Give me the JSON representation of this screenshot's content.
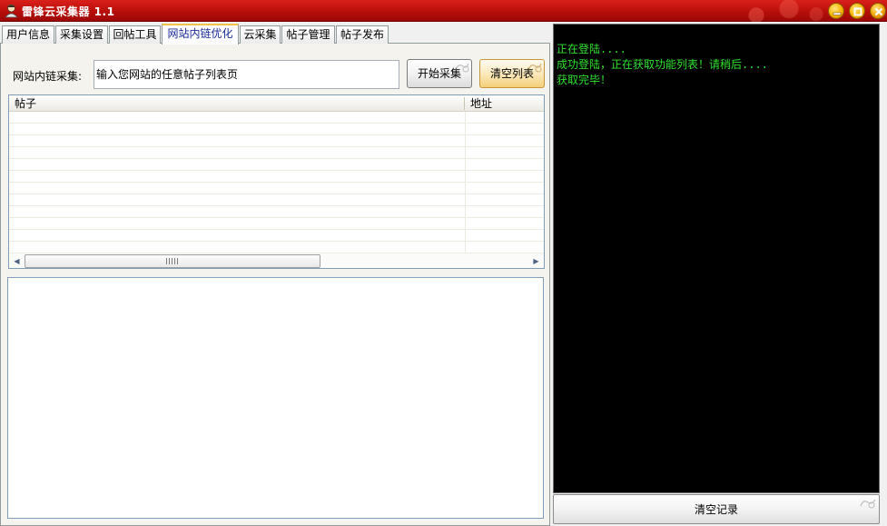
{
  "window": {
    "title": "雷锋云采集器 1.1",
    "icons": {
      "app": "user-avatar-icon",
      "minimize": "minimize-icon",
      "maximize": "maximize-icon",
      "close": "close-icon"
    },
    "colors": {
      "titlebar": "#c0120d",
      "window_buttons": "#f5b400"
    }
  },
  "tabs": [
    {
      "label": "用户信息"
    },
    {
      "label": "采集设置"
    },
    {
      "label": "回帖工具"
    },
    {
      "label": "网站内链优化",
      "active": true
    },
    {
      "label": "云采集"
    },
    {
      "label": "帖子管理"
    },
    {
      "label": "帖子发布"
    }
  ],
  "collect": {
    "label": "网站内链采集:",
    "input_value": "输入您网站的任意帖子列表页",
    "start_button": "开始采集",
    "clear_button": "清空列表"
  },
  "list": {
    "columns": [
      "帖子",
      "地址"
    ],
    "rows": []
  },
  "log": {
    "lines": [
      "正在登陆....",
      "成功登陆，正在获取功能列表！请稍后....",
      "获取完毕！"
    ],
    "text_color": "#2fe02f",
    "background": "#000000",
    "clear_button": "清空记录"
  }
}
